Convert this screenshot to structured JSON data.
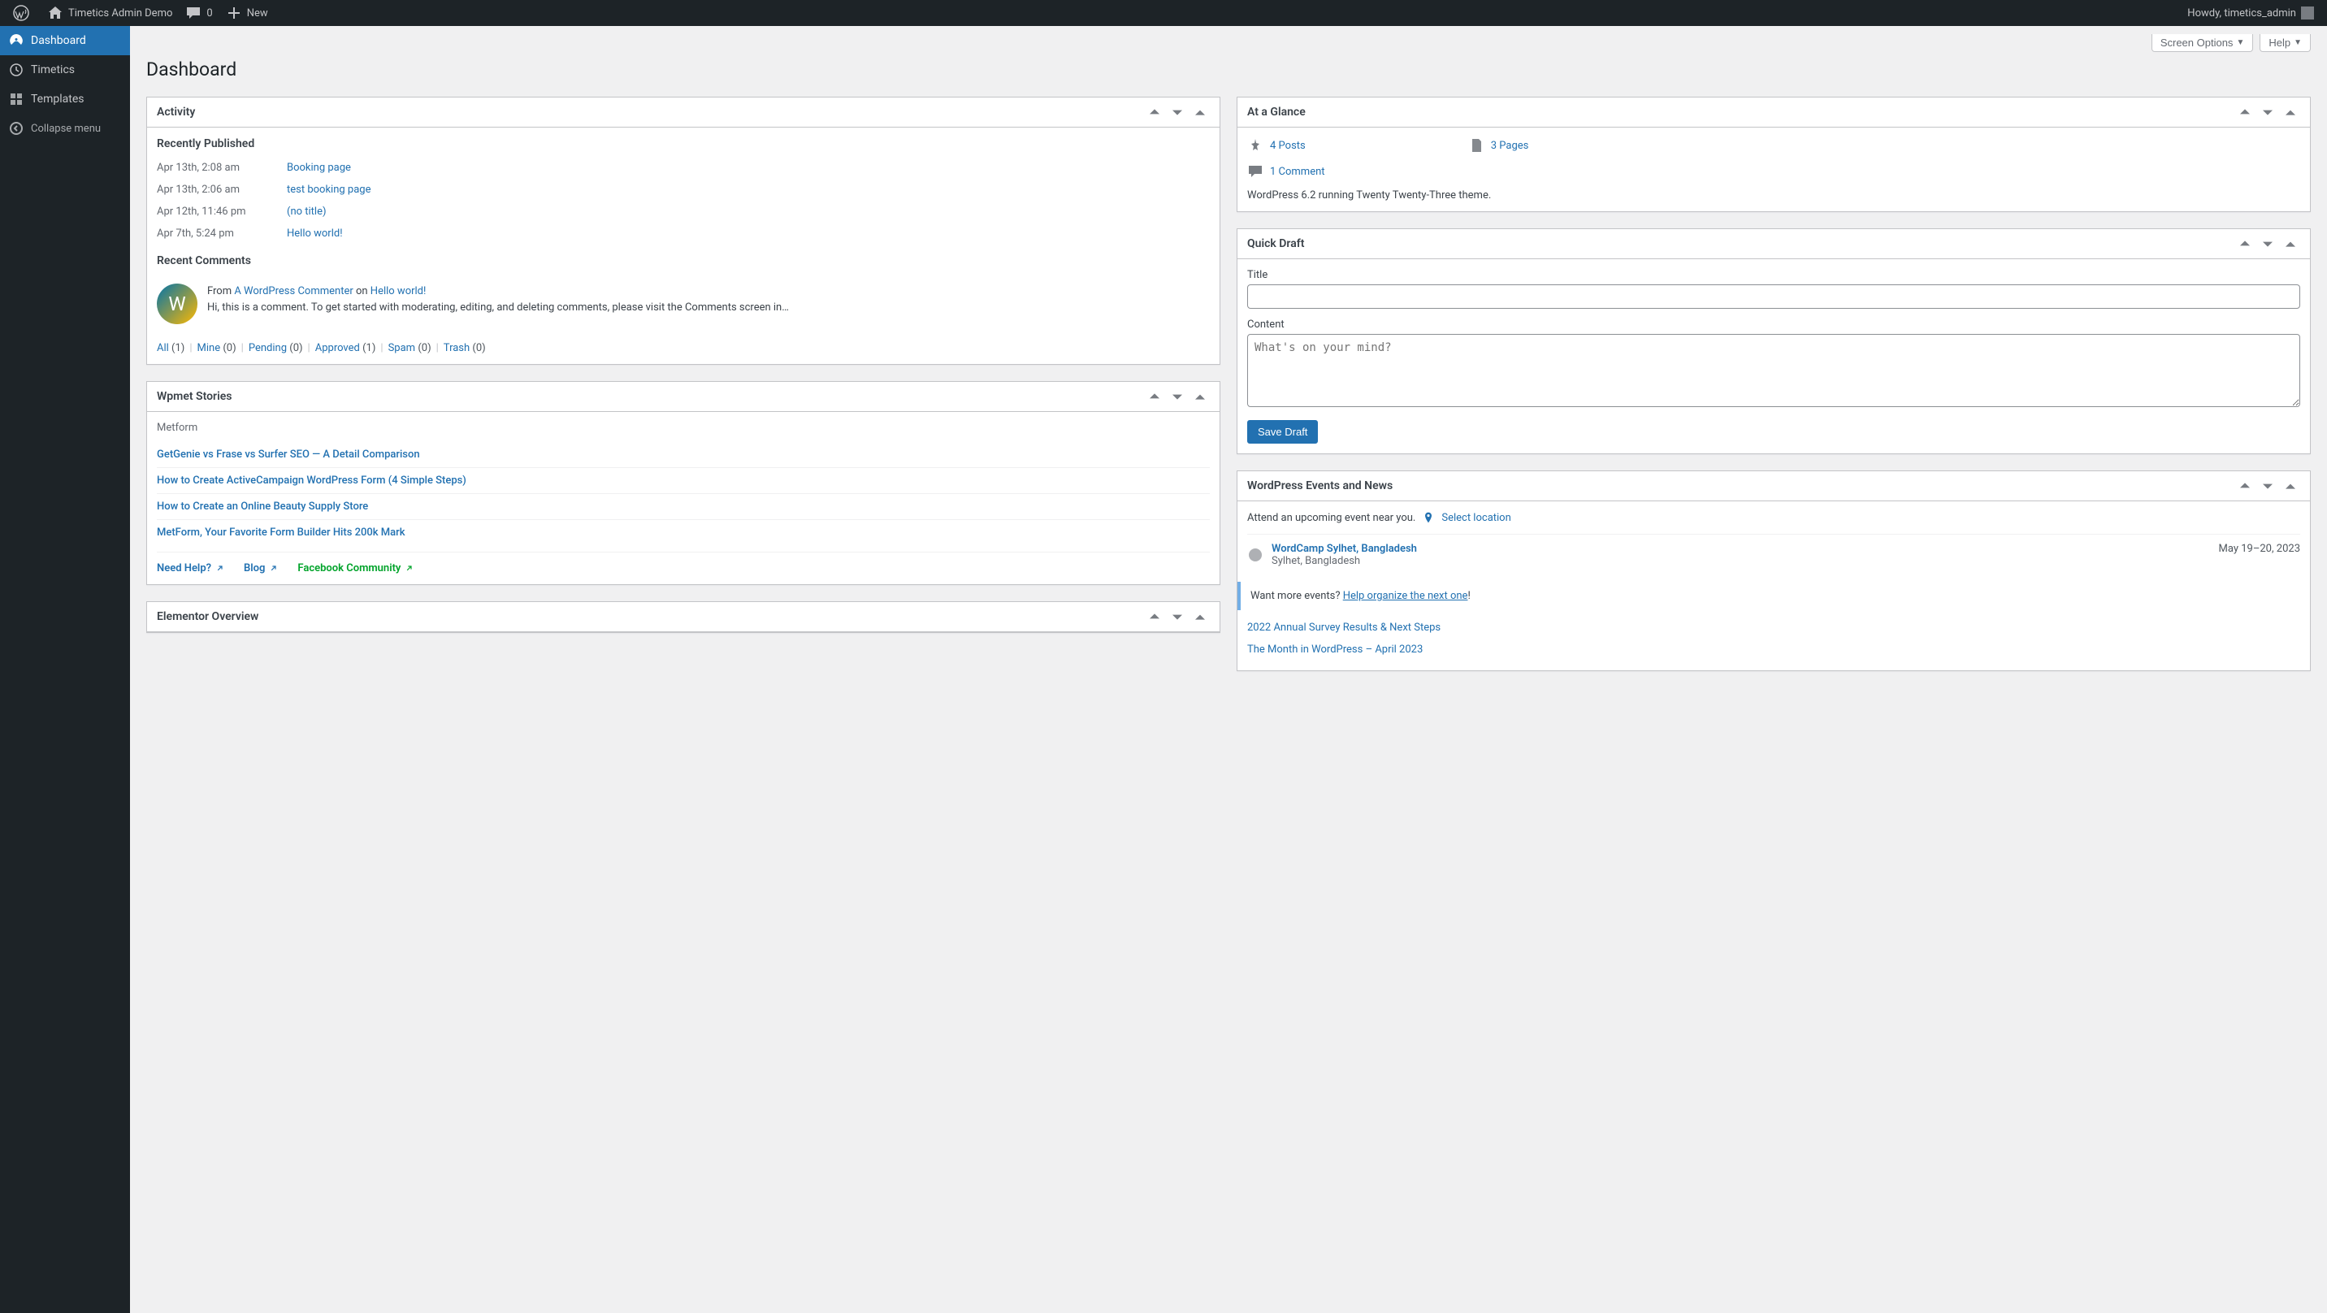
{
  "adminbar": {
    "site_name": "Timetics Admin Demo",
    "comments_count": "0",
    "new_label": "New",
    "howdy": "Howdy, timetics_admin"
  },
  "sidebar": {
    "items": [
      {
        "label": "Dashboard"
      },
      {
        "label": "Timetics"
      },
      {
        "label": "Templates"
      }
    ],
    "collapse": "Collapse menu"
  },
  "top": {
    "screen_options": "Screen Options",
    "help": "Help"
  },
  "page_title": "Dashboard",
  "activity": {
    "title": "Activity",
    "recently_published": "Recently Published",
    "posts": [
      {
        "date": "Apr 13th, 2:08 am",
        "title": "Booking page"
      },
      {
        "date": "Apr 13th, 2:06 am",
        "title": "test booking page"
      },
      {
        "date": "Apr 12th, 11:46 pm",
        "title": "(no title)"
      },
      {
        "date": "Apr 7th, 5:24 pm",
        "title": "Hello world!"
      }
    ],
    "recent_comments": "Recent Comments",
    "comment": {
      "from": "From ",
      "author": "A WordPress Commenter",
      "on": " on ",
      "post": "Hello world!",
      "excerpt": "Hi, this is a comment. To get started with moderating, editing, and deleting comments, please visit the Comments screen in…"
    },
    "filters": {
      "all": "All",
      "all_count": "(1)",
      "mine": "Mine",
      "mine_count": "(0)",
      "pending": "Pending",
      "pending_count": "(0)",
      "approved": "Approved",
      "approved_count": "(1)",
      "spam": "Spam",
      "spam_count": "(0)",
      "trash": "Trash",
      "trash_count": "(0)"
    }
  },
  "wpmet": {
    "title": "Wpmet Stories",
    "category": "Metform",
    "stories": [
      "GetGenie vs Frase vs Surfer SEO — A Detail Comparison",
      "How to Create ActiveCampaign WordPress Form (4 Simple Steps)",
      "How to Create an Online Beauty Supply Store",
      "MetForm, Your Favorite Form Builder Hits 200k Mark"
    ],
    "need_help": "Need Help?",
    "blog": "Blog",
    "fb": "Facebook Community"
  },
  "elementor": {
    "title": "Elementor Overview"
  },
  "glance": {
    "title": "At a Glance",
    "posts": "4 Posts",
    "pages": "3 Pages",
    "comments": "1 Comment",
    "version": "WordPress 6.2 running Twenty Twenty-Three theme."
  },
  "quickdraft": {
    "title": "Quick Draft",
    "title_label": "Title",
    "content_label": "Content",
    "content_placeholder": "What's on your mind?",
    "save": "Save Draft"
  },
  "events": {
    "title": "WordPress Events and News",
    "attend": "Attend an upcoming event near you.",
    "select_location": "Select location",
    "event": {
      "name": "WordCamp Sylhet, Bangladesh",
      "location": "Sylhet, Bangladesh",
      "date": "May 19–20, 2023"
    },
    "want_more": "Want more events? ",
    "organize": "Help organize the next one",
    "exclaim": "!",
    "news": [
      "2022 Annual Survey Results & Next Steps",
      "The Month in WordPress – April 2023"
    ]
  }
}
